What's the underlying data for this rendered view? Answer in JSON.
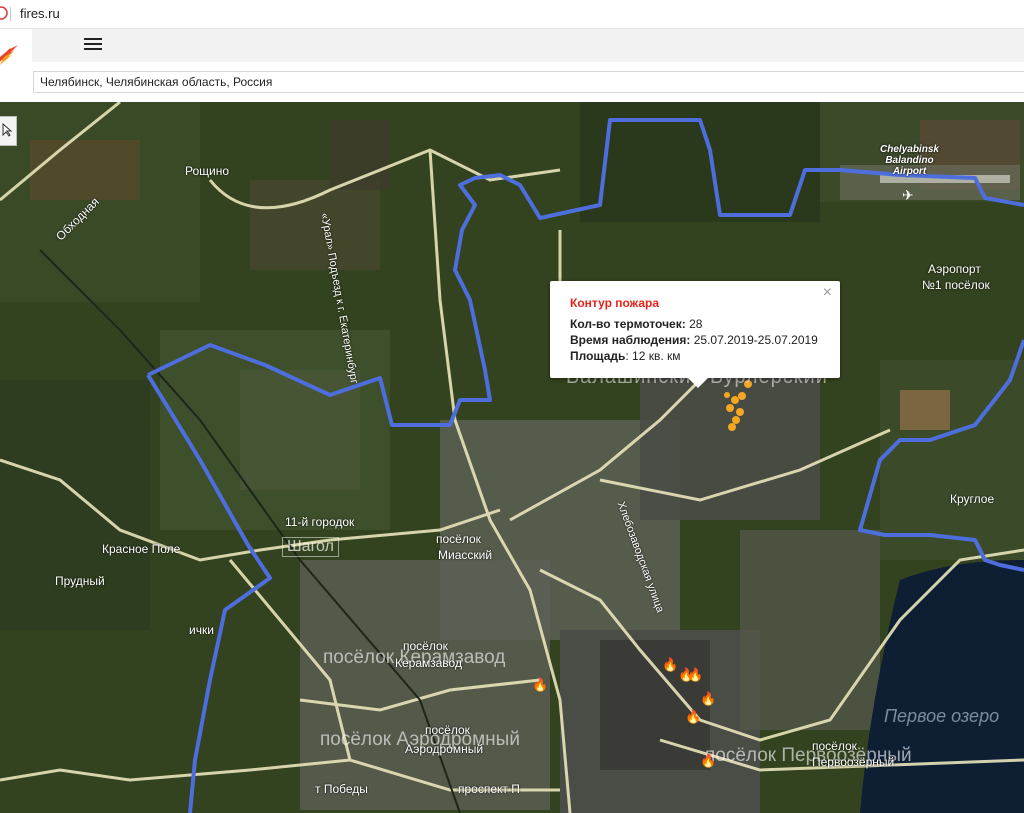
{
  "browser": {
    "url": "fires.ru"
  },
  "app": {
    "search_value": "Челябинск, Челябинская область, Россия"
  },
  "popup": {
    "title": "Контур пожара",
    "rows": [
      {
        "label": "Кол-во термоточек:",
        "value": "28"
      },
      {
        "label": "Время наблюдения:",
        "value": "25.07.2019-25.07.2019"
      },
      {
        "label": "Площадь",
        "value": ": 12 кв. км"
      }
    ],
    "close": "×"
  },
  "map_labels": {
    "obhod": "Обходная",
    "roshchino": "Рощино",
    "ural_road": "«Урал» Подъезд к г. Екатеринбург",
    "airport_en": "Chelyabinsk Balandino Airport",
    "aeroport": "Аэропорт",
    "poselok1": "№1 посёлок",
    "poselok_big": "Балашинский Бурлерский",
    "krugloe": "Круглое",
    "gorodok11": "11-й городок",
    "shagol": "Шагол",
    "poselok_miass": "посёлок",
    "miassky": "Миасский",
    "krasnoe_pole": "Красное Поле",
    "prudny": "Прудный",
    "ichki": "ички",
    "khlebozavod": "Хлебозаводская улица",
    "poselok_k": "посёлок",
    "keramzavod": "Керамзавод",
    "poselok_keramzavod_big": "посёлок Керамзавод",
    "poselok_a": "посёлок",
    "aerodromny": "Аэродромный",
    "poselok_aerodromny_big": "посёлок Аэродромный",
    "pobedy": "т Победы",
    "prospekt": "проспект П",
    "pervoe_ozero": "Первое озеро",
    "poselok_p": "посёлок",
    "pervoozerny": "Первоозёрный",
    "poselok_pervoozerny_big": "посёлок Первоозёрный"
  },
  "colors": {
    "boundary": "#4d6edc",
    "popup_title": "#e3241b",
    "hotspot": "#f5a623",
    "road": "#e9e4bb"
  }
}
